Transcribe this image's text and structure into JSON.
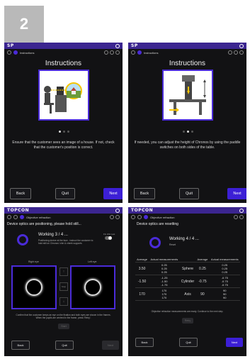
{
  "step_badge": "2",
  "screens": {
    "s1": {
      "brand": "SP",
      "subtitle": "Instructions",
      "title": "Instructions",
      "caption": "Ensure that the customer sees an image of a house. If not, check that the customer's position is correct.",
      "back": "Back",
      "quit": "Quit",
      "next": "Next"
    },
    "s2": {
      "brand": "SP",
      "subtitle": "Instructions",
      "title": "Instructions",
      "caption": "If needed, you can adjust the height of Chronos by using the paddle switches on both sides of the table.",
      "back": "Back",
      "quit": "Quit",
      "next": "Next"
    },
    "s3": {
      "brand": "TOPCON",
      "subtitle": "Objective refraction",
      "heading": "Device optics are positioning, please hold still...",
      "working": "Working 3 / 4 ...",
      "working_sub": "Positioning device at the face - instruct the customer to hold still on Chronos' chin & cheek supports",
      "toggle_label": "Fix chin rest",
      "right_eye": "Right eye",
      "left_eye": "Left eye",
      "mid_label": "Stop",
      "help_text": "Confirm that the customer keeps an eye on the fixation and both eyes are shown in the frames. When the pupils are centred in the frame, press 'Retry'.",
      "retry": "Start",
      "back": "Back",
      "quit": "Quit",
      "next": "Next"
    },
    "s4": {
      "brand": "TOPCON",
      "subtitle": "Objective refraction",
      "heading": "Device optics are resetting",
      "working": "Working 4 / 4 ...",
      "working_sub": "Reset",
      "col_average": "Average",
      "col_actual": "Actual measurements",
      "rows": [
        {
          "avg_r": "3.50",
          "meas_r": [
            "0.25",
            "0.25",
            "0.25"
          ],
          "label": "Sphere",
          "avg_l": "0.25",
          "meas_l": [
            "0.25",
            "0.25",
            "0.25"
          ]
        },
        {
          "avg_r": "-1.50",
          "meas_r": [
            "-1.25",
            "-1.50",
            "-1.75"
          ],
          "label": "Cylinder",
          "avg_l": "-0.75",
          "meas_l": [
            "-0.75",
            "-0.75",
            "-0.75"
          ]
        },
        {
          "avg_r": "170",
          "meas_r": [
            "170",
            "170",
            "170"
          ],
          "label": "Axis",
          "avg_l": "90",
          "meas_l": [
            "90",
            "90",
            "90"
          ]
        }
      ],
      "note": "Objective refraction measurements are ready. Continue to the next step.",
      "retry": "Retry",
      "back": "Back",
      "quit": "Quit",
      "next": "Next"
    }
  }
}
